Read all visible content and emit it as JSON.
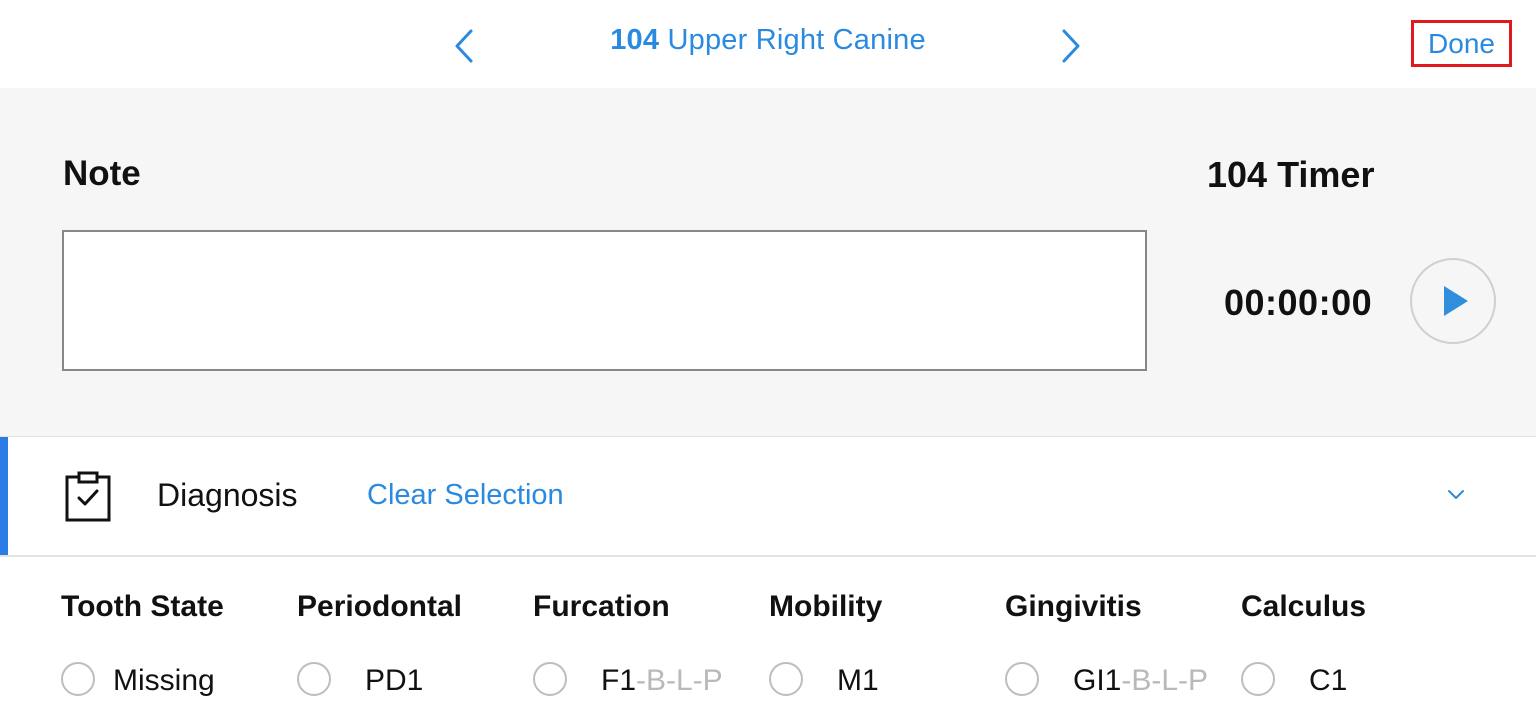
{
  "header": {
    "tooth_number": "104",
    "tooth_name": "Upper Right Canine",
    "done_label": "Done",
    "prev_icon": "chevron-left-icon",
    "next_icon": "chevron-right-icon",
    "accent_color": "#2a8ae0",
    "highlight_color": "#e0191f"
  },
  "note": {
    "label": "Note",
    "value": ""
  },
  "timer": {
    "label": "104 Timer",
    "value": "00:00:00",
    "play_icon": "play-icon"
  },
  "diagnosis": {
    "icon": "clipboard-check-icon",
    "label": "Diagnosis",
    "clear_label": "Clear Selection",
    "expand_icon": "chevron-down-icon"
  },
  "categories": [
    {
      "title": "Tooth State",
      "option": "Missing",
      "suffix": ""
    },
    {
      "title": "Periodontal",
      "option": "PD1",
      "suffix": ""
    },
    {
      "title": "Furcation",
      "option": "F1",
      "suffix": "-B-L-P"
    },
    {
      "title": "Mobility",
      "option": "M1",
      "suffix": ""
    },
    {
      "title": "Gingivitis",
      "option": "GI1",
      "suffix": "-B-L-P"
    },
    {
      "title": "Calculus",
      "option": "C1",
      "suffix": ""
    }
  ]
}
